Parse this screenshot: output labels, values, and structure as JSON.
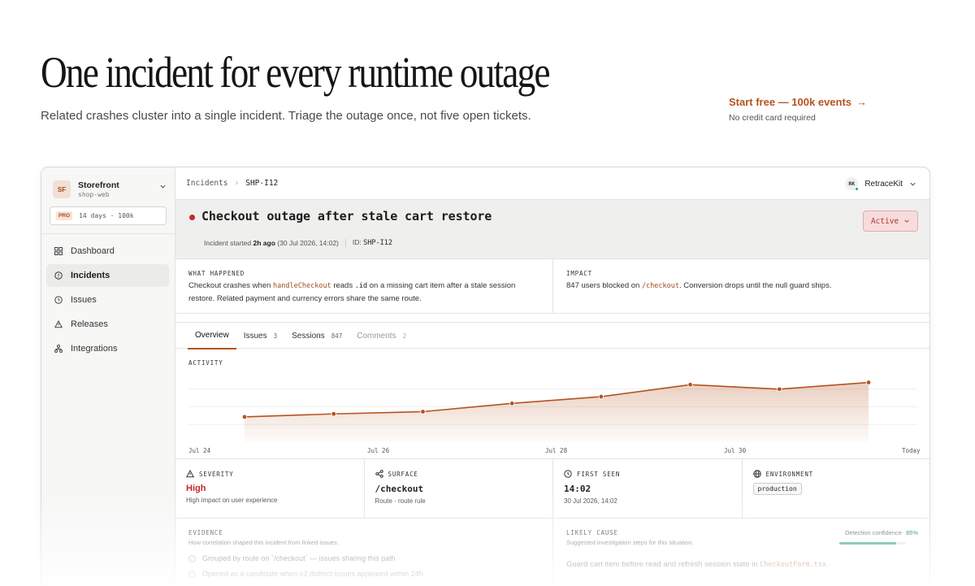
{
  "hero": {
    "title": "One incident for every runtime outage",
    "subtitle": "Related crashes cluster into a single incident. Triage the outage once, not five open tickets.",
    "cta_label": "Start free — 100k events",
    "cta_arrow": "→",
    "cta_note": "No credit card required"
  },
  "sidebar": {
    "workspace_badge": "SF",
    "workspace_name": "Storefront",
    "workspace_slug": "shop-web",
    "plan_tag": "PRO",
    "plan_text": "14 days · 100k",
    "items": [
      {
        "label": "Dashboard",
        "icon": "grid-icon"
      },
      {
        "label": "Incidents",
        "icon": "alert-circle-icon"
      },
      {
        "label": "Issues",
        "icon": "clock-icon"
      },
      {
        "label": "Releases",
        "icon": "warning-triangle-icon"
      },
      {
        "label": "Integrations",
        "icon": "network-icon"
      }
    ],
    "active_index": 1
  },
  "topbar": {
    "crumb_root": "Incidents",
    "crumb_sep": "›",
    "crumb_current": "SHP-I12",
    "user_initials": "RK",
    "user_name": "RetraceKit"
  },
  "incident": {
    "title": "Checkout outage after stale cart restore",
    "started_label": "Incident started",
    "started_ago": "2h ago",
    "started_date": "(30 Jul 2026, 14:02)",
    "id_label": "ID:",
    "id_value": "SHP-I12",
    "status": "Active",
    "status_color": "#b2362f"
  },
  "what_happened": {
    "label": "WHAT HAPPENED",
    "text_a": "Checkout crashes when",
    "code_a": "handleCheckout",
    "text_b": "reads",
    "code_b": ".id",
    "text_c": "on a missing cart item after a stale session restore. Related payment and currency errors share the same route."
  },
  "impact": {
    "label": "IMPACT",
    "text_a": "847 users blocked on",
    "code_a": "/checkout",
    "text_b": ". Conversion drops until the null guard ships."
  },
  "tabs": [
    {
      "label": "Overview",
      "count": ""
    },
    {
      "label": "Issues",
      "count": "3"
    },
    {
      "label": "Sessions",
      "count": "847"
    },
    {
      "label": "Comments",
      "count": "2"
    }
  ],
  "chart_data": {
    "type": "area",
    "title": "ACTIVITY",
    "x_tick_labels": [
      "Jul 24",
      "Jul 26",
      "Jul 28",
      "Jul 30",
      "Today"
    ],
    "points": [
      1,
      2,
      3,
      4,
      5,
      6,
      7,
      8,
      9
    ],
    "values": [
      12,
      16,
      19,
      30,
      39,
      55,
      49,
      58
    ],
    "ylim": [
      0,
      100
    ],
    "grid": true,
    "color": "#b4531f"
  },
  "cards": {
    "severity_label": "SEVERITY",
    "severity_value": "High",
    "severity_sub": "High impact on user experience",
    "surface_label": "SURFACE",
    "surface_value": "/checkout",
    "surface_sub": "Route · route rule",
    "first_seen_label": "FIRST SEEN",
    "first_seen_value": "14:02",
    "first_seen_sub": "30 Jul 2026, 14:02",
    "environment_label": "ENVIRONMENT",
    "environment_value": "production"
  },
  "evidence": {
    "label": "EVIDENCE",
    "sub": "How correlation shaped this incident from linked issues.",
    "items": [
      "Grouped by route on `/checkout` — issues sharing this path",
      "Opened as a candidate when ≥2 distinct issues appeared within 24h"
    ]
  },
  "likely_cause": {
    "label": "LIKELY CAUSE",
    "sub": "Suggested investigation steps for this situation.",
    "confidence_label": "Detection confidence",
    "confidence_value": "85%",
    "confidence_fraction": 0.85,
    "text_a": "Guard cart item before read and refresh session state in",
    "code_a": "CheckoutForm.tsx",
    "text_b": "."
  }
}
